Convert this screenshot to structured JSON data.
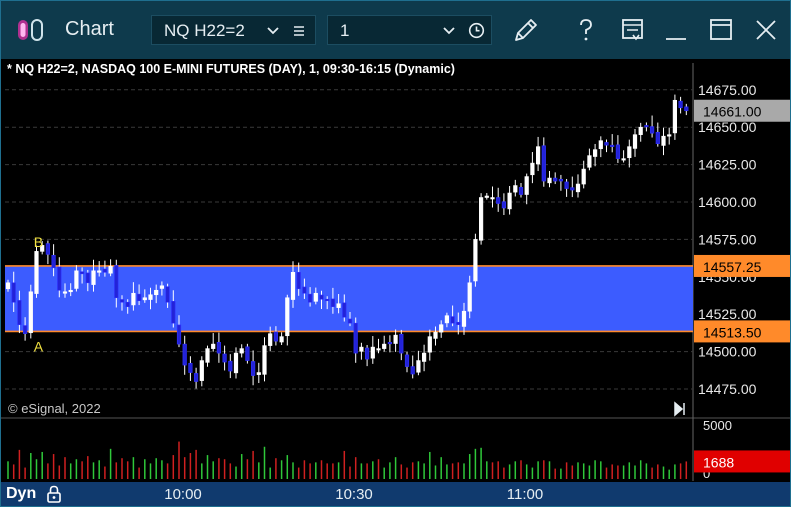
{
  "window": {
    "title": "Chart",
    "symbol": "NQ H22=2",
    "interval": "1"
  },
  "chart_header": "* NQ H22=2, NASDAQ 100 E-MINI FUTURES (DAY), 1, 09:30-16:15 (Dynamic)",
  "copyright": "© eSignal, 2022",
  "status": {
    "mode": "Dyn"
  },
  "colors": {
    "titlebar": "#0e3a4c",
    "up_candle": "#ffffff",
    "down_candle": "#2323d8",
    "zone_fill": "#3c5cff",
    "zone_border": "#ff8a2a",
    "last_price_bg": "#a9a9a9",
    "volume_label_bg": "#e00000",
    "status_bar": "#103a6e"
  },
  "chart_data": {
    "type": "candlestick",
    "title": "* NQ H22=2, NASDAQ 100 E-MINI FUTURES (DAY), 1, 09:30-16:15 (Dynamic)",
    "ylim": [
      14460,
      14690
    ],
    "y_ticks": [
      "14675.00",
      "14650.00",
      "14625.00",
      "14600.00",
      "14575.00",
      "14550.00",
      "14525.00",
      "14500.00",
      "14475.00"
    ],
    "y_tick_values": [
      14675,
      14650,
      14625,
      14600,
      14575,
      14550,
      14525,
      14500,
      14475
    ],
    "x_ticks": [
      "10:00",
      "10:30",
      "11:00"
    ],
    "x_tick_bars": [
      30,
      60,
      90
    ],
    "last_price": "14661.00",
    "last_price_value": 14661,
    "zone": {
      "upper_label": "14557.25",
      "upper": 14557.25,
      "lower_label": "14513.50",
      "lower": 14513.5
    },
    "point_labels": [
      {
        "text": "B",
        "bar": 4,
        "price": 14570
      },
      {
        "text": "A",
        "bar": 4,
        "price": 14500
      }
    ],
    "close": [
      14546,
      14533,
      14518,
      14512,
      14540,
      14567,
      14571,
      14565,
      14556,
      14541,
      14540,
      14541,
      14554,
      14552,
      14546,
      14554,
      14554,
      14553,
      14557,
      14536,
      14533,
      14530,
      14539,
      14534,
      14536,
      14538,
      14541,
      14544,
      14533,
      14519,
      14505,
      14491,
      14486,
      14480,
      14494,
      14502,
      14505,
      14499,
      14493,
      14487,
      14499,
      14502,
      14494,
      14484,
      14486,
      14504,
      14512,
      14507,
      14510,
      14536,
      14553,
      14542,
      14539,
      14533,
      14539,
      14535,
      14534,
      14530,
      14532,
      14523,
      14519,
      14499,
      14503,
      14495,
      14503,
      14502,
      14505,
      14506,
      14511,
      14499,
      14490,
      14485,
      14494,
      14499,
      14510,
      14513,
      14518,
      14524,
      14519,
      14518,
      14527,
      14546,
      14575,
      14603,
      14604,
      14603,
      14599,
      14596,
      14606,
      14611,
      14605,
      14617,
      14626,
      14637,
      14614,
      14616,
      14614,
      14614,
      14609,
      14608,
      14612,
      14622,
      14631,
      14635,
      14641,
      14638,
      14637,
      14629,
      14629,
      14637,
      14645,
      14650,
      14651,
      14646,
      14639,
      14644,
      14645,
      14668,
      14663,
      14661
    ],
    "volume_max_label": "5000",
    "volume_min_label": "0",
    "volume_last_label": "1688",
    "volume_last": 1688,
    "volume": [
      1700,
      1400,
      2800,
      1100,
      2500,
      1900,
      2600,
      1500,
      2400,
      1300,
      2100,
      1500,
      1900,
      1700,
      2200,
      1600,
      1800,
      1200,
      2900,
      1600,
      2000,
      1700,
      2100,
      1100,
      1900,
      1500,
      2000,
      1800,
      1500,
      2300,
      3600,
      2100,
      2500,
      2800,
      1500,
      2300,
      1700,
      2000,
      1900,
      1500,
      1200,
      2400,
      1900,
      2700,
      1600,
      3100,
      1100,
      2000,
      1800,
      2300,
      1600,
      1100,
      1800,
      1500,
      1600,
      1800,
      1500,
      1500,
      1600,
      2700,
      1200,
      2100,
      1500,
      1500,
      1700,
      1900,
      1100,
      1600,
      2100,
      1400,
      1100,
      1600,
      1700,
      1500,
      2600,
      1300,
      2100,
      1400,
      1500,
      1600,
      1500,
      2400,
      2900,
      3000,
      1700,
      1600,
      1700,
      1100,
      1400,
      1700,
      1800,
      1400,
      1100,
      1700,
      1800,
      1700,
      1000,
      1000,
      1600,
      1300,
      1600,
      1500,
      1300,
      1800,
      1700,
      1100,
      1400,
      1300,
      1300,
      1600,
      1300,
      1800,
      1500,
      1100,
      1400,
      1200,
      900,
      1400,
      1500,
      1688
    ]
  }
}
